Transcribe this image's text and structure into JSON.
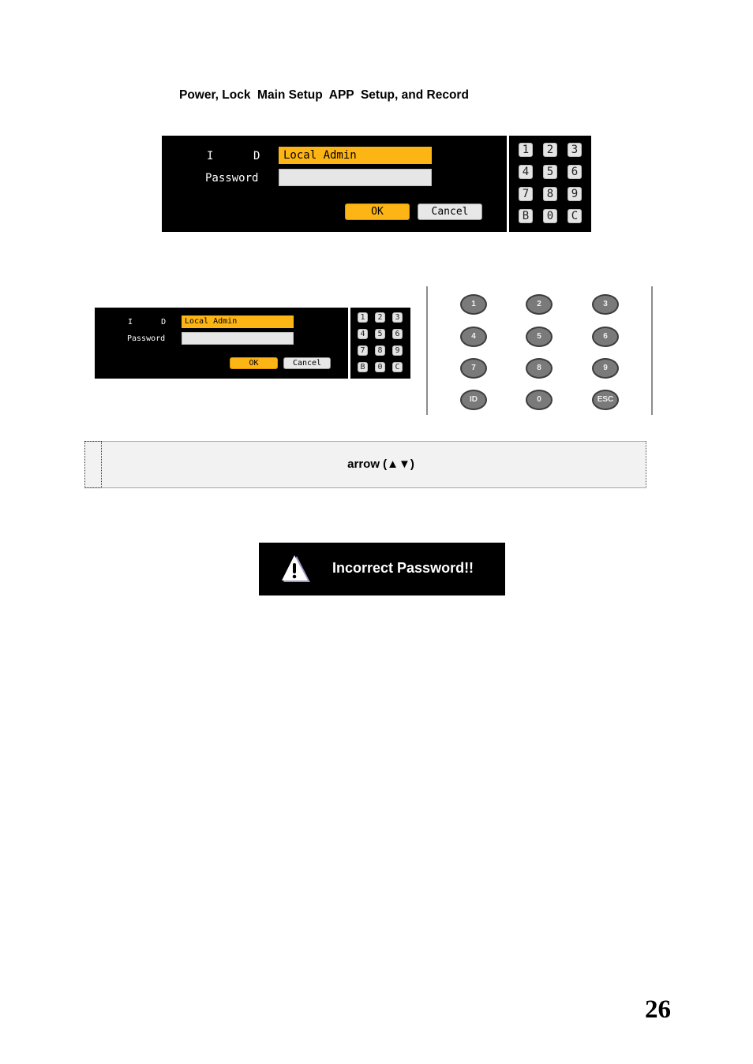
{
  "heading": "Power, Lock  Main Setup  APP  Setup, and Record",
  "login_dialog": {
    "id_label": "I      D",
    "password_label": "Password",
    "id_value": "Local Admin",
    "password_value": "",
    "ok_label": "OK",
    "cancel_label": "Cancel",
    "colors": {
      "accent": "#fdb515",
      "background": "#000000",
      "field": "#e6e6e6"
    }
  },
  "onscreen_keypad": {
    "keys": [
      "1",
      "2",
      "3",
      "4",
      "5",
      "6",
      "7",
      "8",
      "9",
      "B",
      "0",
      "C"
    ]
  },
  "remote_keypad": {
    "keys": [
      "1",
      "2",
      "3",
      "4",
      "5",
      "6",
      "7",
      "8",
      "9",
      "ID",
      "0",
      "ESC"
    ]
  },
  "note": {
    "text": "arrow  (▲▼)"
  },
  "alert": {
    "icon": "warning-icon",
    "message": "Incorrect Password!!"
  },
  "page_number": "26"
}
